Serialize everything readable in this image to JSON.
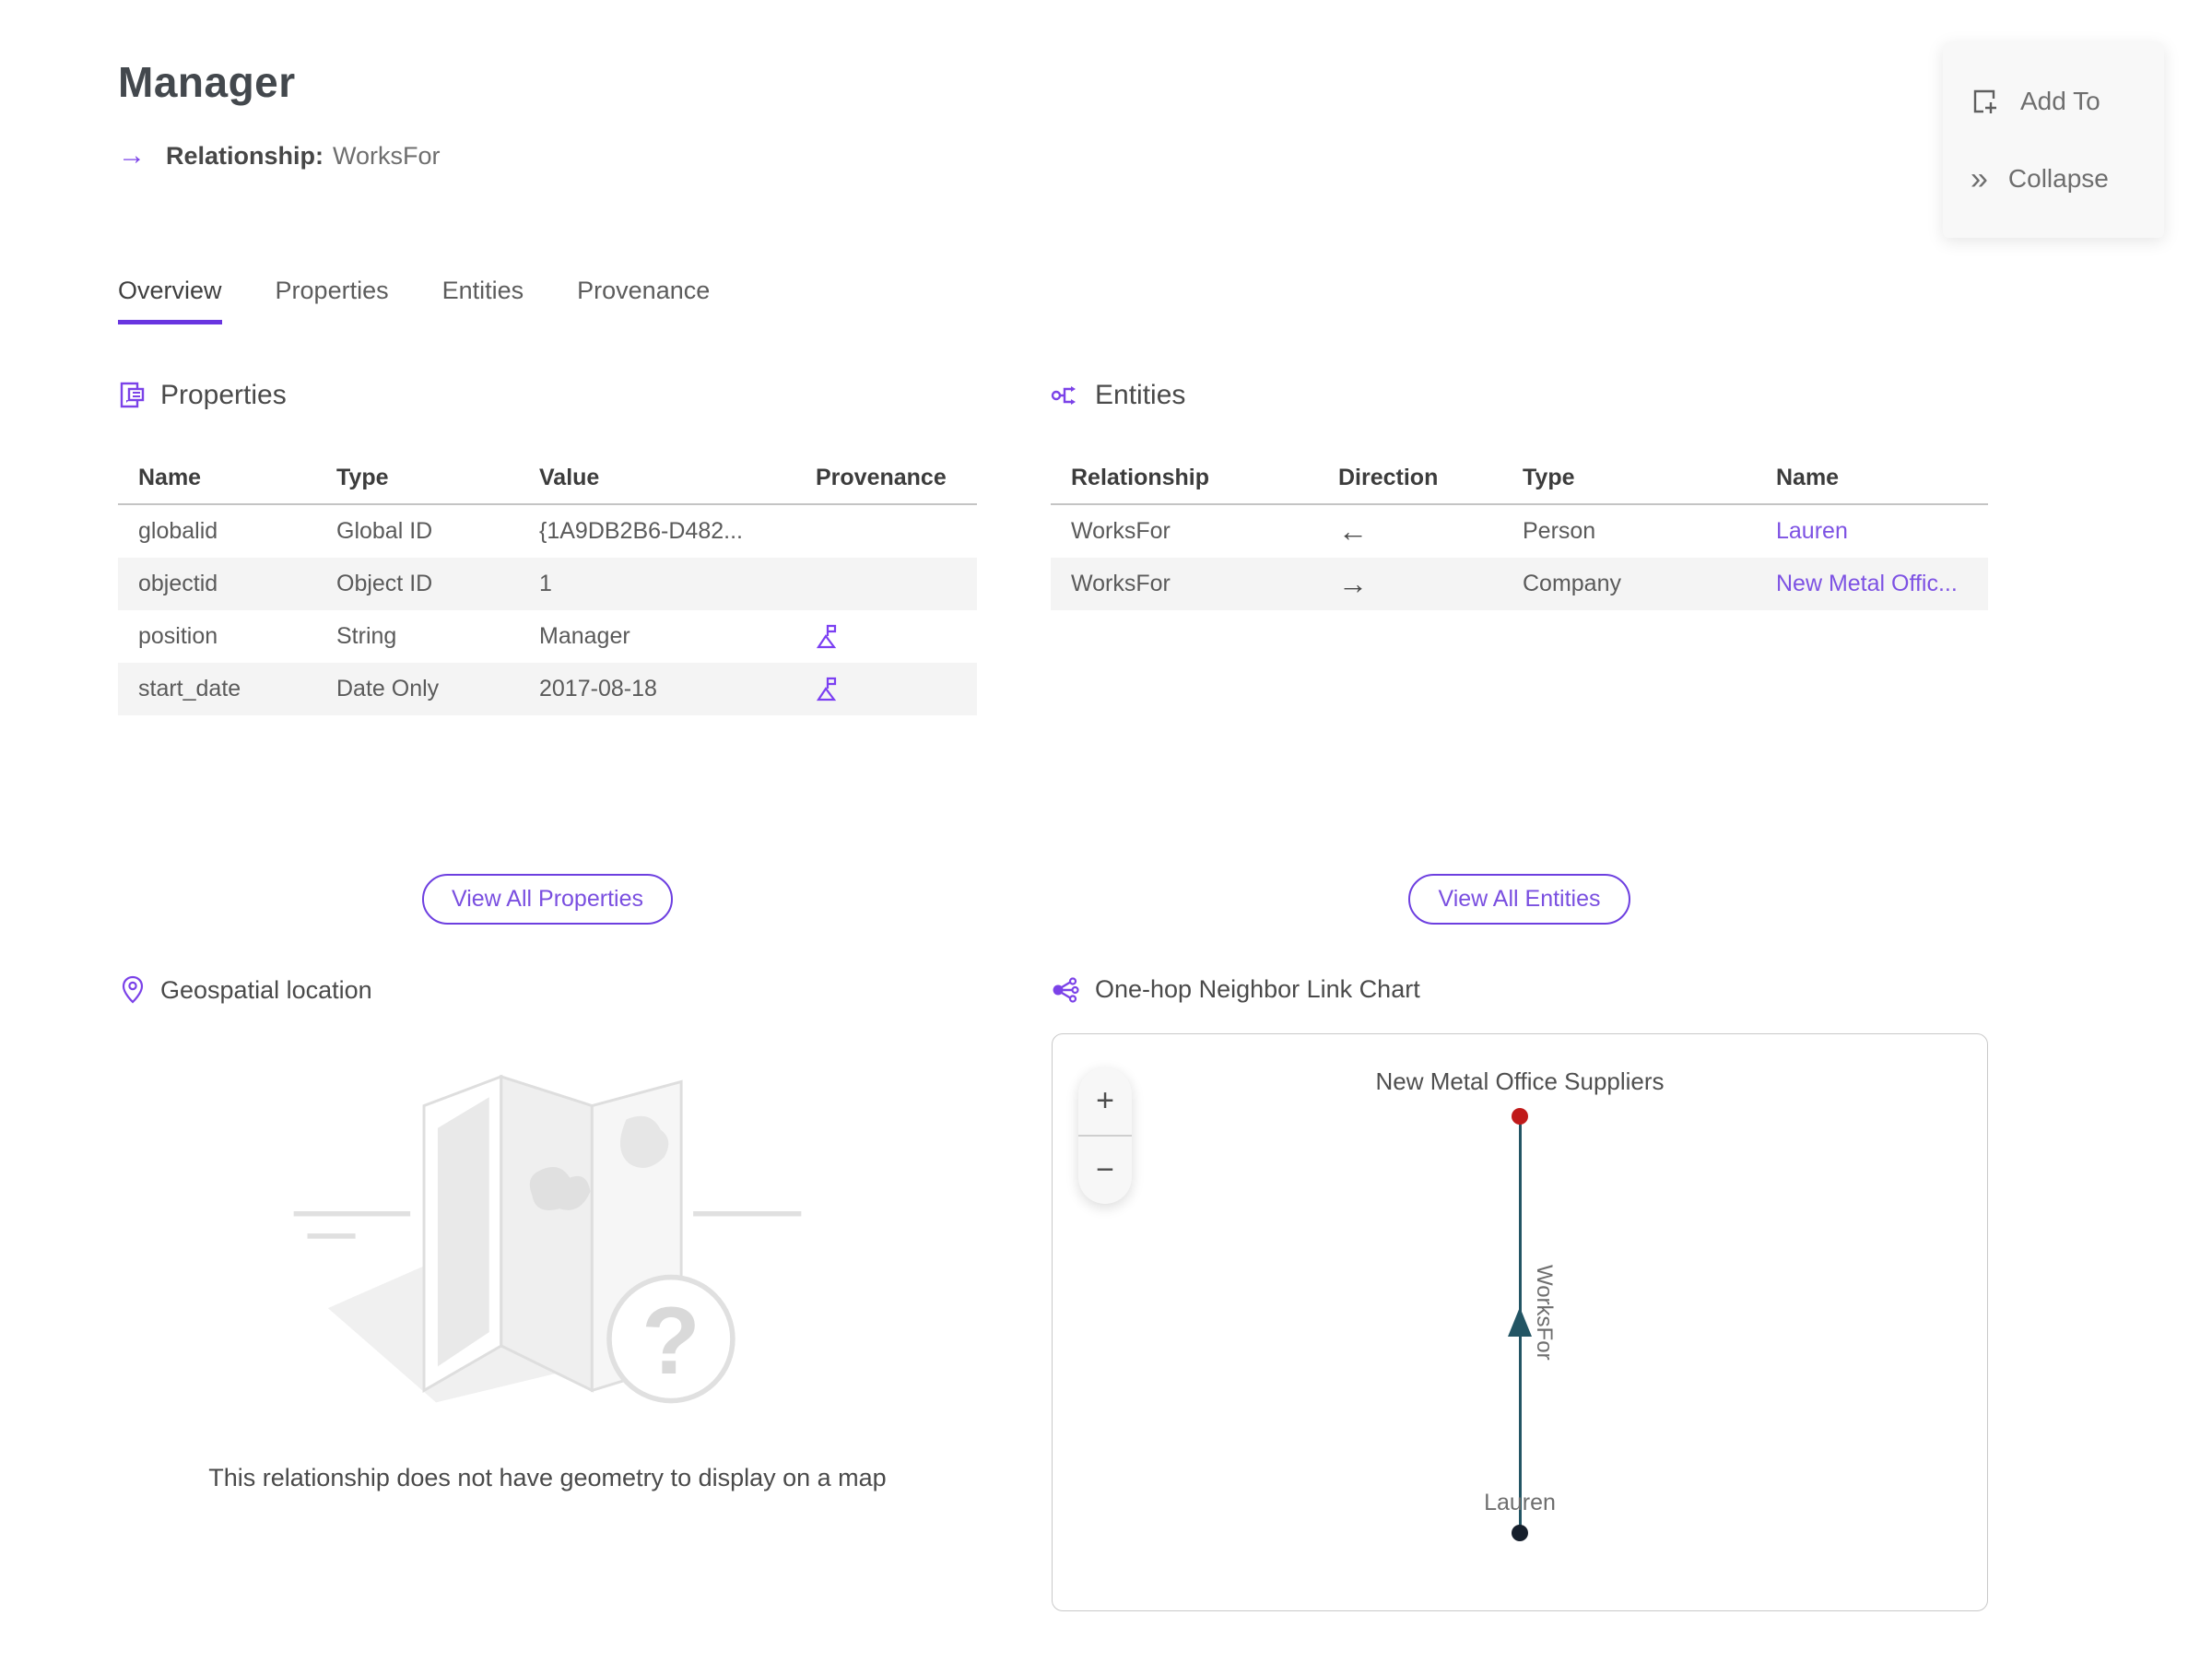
{
  "page": {
    "title": "Manager"
  },
  "subtitle": {
    "arrow": "→",
    "label": "Relationship:",
    "value": "WorksFor"
  },
  "actions": {
    "add_to": "Add To",
    "collapse": "Collapse",
    "collapse_glyph": "»"
  },
  "tabs": {
    "overview": "Overview",
    "properties": "Properties",
    "entities": "Entities",
    "provenance": "Provenance"
  },
  "properties": {
    "heading": "Properties",
    "columns": {
      "name": "Name",
      "type": "Type",
      "value": "Value",
      "provenance": "Provenance"
    },
    "rows": [
      {
        "name": "globalid",
        "type": "Global ID",
        "value": "{1A9DB2B6-D482..."
      },
      {
        "name": "objectid",
        "type": "Object ID",
        "value": "1"
      },
      {
        "name": "position",
        "type": "String",
        "value": "Manager"
      },
      {
        "name": "start_date",
        "type": "Date Only",
        "value": "2017-08-18"
      }
    ],
    "view_all": "View All Properties"
  },
  "entities": {
    "heading": "Entities",
    "columns": {
      "relationship": "Relationship",
      "direction": "Direction",
      "type": "Type",
      "name": "Name"
    },
    "rows": [
      {
        "relationship": "WorksFor",
        "direction": "←",
        "type": "Person",
        "name": "Lauren"
      },
      {
        "relationship": "WorksFor",
        "direction": "→",
        "type": "Company",
        "name": "New Metal Offic..."
      }
    ],
    "view_all": "View All Entities"
  },
  "geospatial": {
    "heading": "Geospatial location",
    "placeholder_glyph": "?",
    "empty_message": "This relationship does not have geometry to display on a map"
  },
  "link_chart": {
    "heading": "One-hop Neighbor Link Chart",
    "zoom_in": "+",
    "zoom_out": "−",
    "top_node": "New Metal Office Suppliers",
    "edge": "WorksFor",
    "bottom_node": "Lauren"
  },
  "colors": {
    "accent": "#7b42e8",
    "link": "#7d52e3",
    "edge_line": "#235564",
    "node_top": "#c01a1a",
    "node_bottom": "#161f2c"
  }
}
